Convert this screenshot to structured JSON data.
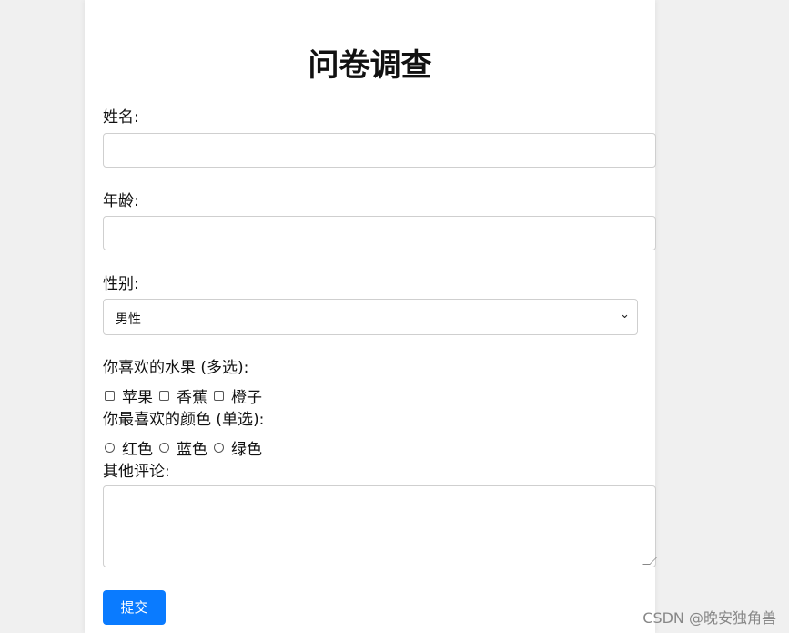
{
  "form": {
    "title": "问卷调查",
    "name_label": "姓名:",
    "name_value": "",
    "age_label": "年龄:",
    "age_value": "",
    "gender_label": "性别:",
    "gender_selected": "男性",
    "fruit_label": "你喜欢的水果 (多选):",
    "fruits": [
      "苹果",
      "香蕉",
      "橙子"
    ],
    "color_label": "你最喜欢的颜色 (单选):",
    "colors": [
      "红色",
      "蓝色",
      "绿色"
    ],
    "comment_label": "其他评论:",
    "comment_value": "",
    "submit_label": "提交"
  },
  "watermark": "CSDN @晚安独角兽",
  "colors_theme": {
    "page_bg": "#f0f0f0",
    "card_bg": "#ffffff",
    "button_bg": "#0a7bff",
    "button_text": "#ffffff",
    "border": "#cfcfcf"
  }
}
